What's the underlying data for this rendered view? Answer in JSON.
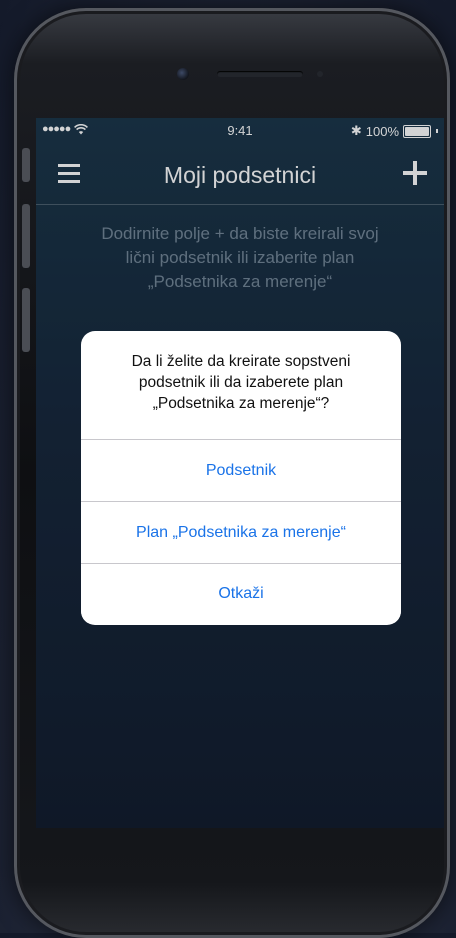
{
  "status_bar": {
    "signal": "●●●●●",
    "wifi_icon": "wifi-icon",
    "time": "9:41",
    "bluetooth": "✱",
    "battery": "100%",
    "battery_level": 1.0
  },
  "nav": {
    "title": "Moji podsetnici",
    "menu_icon": "hamburger-menu-icon",
    "add_icon": "plus-icon"
  },
  "hint": {
    "line1": "Dodirnite polje + da biste kreirali svoj",
    "line2": "lični podsetnik ili izaberite plan",
    "line3": "„Podsetnika za merenje“"
  },
  "alert": {
    "message_line1": "Da li želite da kreirate sopstveni",
    "message_line2": "podsetnik ili da izaberete plan",
    "message_line3": "„Podsetnika za merenje“?",
    "btn_reminder": "Podsetnik",
    "btn_plan": "Plan „Podsetnika za merenje“",
    "btn_cancel": "Otkaži"
  },
  "colors": {
    "accent": "#1a73e8",
    "screen_bg": "#16263a",
    "hint_text": "#8a9db0"
  }
}
